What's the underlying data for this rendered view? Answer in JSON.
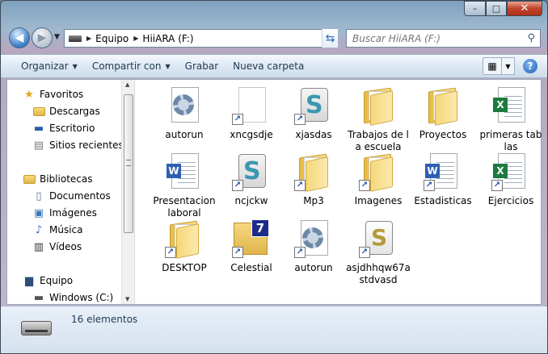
{
  "window": {
    "minimize": "–",
    "maximize": "□",
    "close": "✕"
  },
  "nav": {
    "breadcrumb": [
      "Equipo",
      "HiiARA (F:)"
    ],
    "search_placeholder": "Buscar HiiARA (F:)"
  },
  "toolbar": {
    "organize": "Organizar",
    "share": "Compartir con",
    "burn": "Grabar",
    "new_folder": "Nueva carpeta"
  },
  "sidebar": {
    "favorites": "Favoritos",
    "fav_items": [
      "Descargas",
      "Escritorio",
      "Sitios recientes"
    ],
    "libraries": "Bibliotecas",
    "lib_items": [
      "Documentos",
      "Imágenes",
      "Música",
      "Vídeos"
    ],
    "computer": "Equipo",
    "comp_items": [
      "Windows (C:)"
    ]
  },
  "files": [
    {
      "name": "autorun",
      "type": "gear",
      "shortcut": false
    },
    {
      "name": "xncgsdje",
      "type": "blank",
      "shortcut": true
    },
    {
      "name": "xjasdas",
      "type": "script",
      "shortcut": true
    },
    {
      "name": "Trabajos de la escuela",
      "type": "folder",
      "shortcut": false
    },
    {
      "name": "Proyectos",
      "type": "folder",
      "shortcut": false
    },
    {
      "name": "primeras tablas",
      "type": "excel",
      "shortcut": false
    },
    {
      "name": "Presentacion laboral",
      "type": "word",
      "shortcut": false
    },
    {
      "name": "ncjckw",
      "type": "script",
      "shortcut": true
    },
    {
      "name": "Mp3",
      "type": "folder",
      "shortcut": true
    },
    {
      "name": "Imagenes",
      "type": "folder",
      "shortcut": true
    },
    {
      "name": "Estadisticas",
      "type": "word",
      "shortcut": true
    },
    {
      "name": "Ejercicios",
      "type": "excel",
      "shortcut": true
    },
    {
      "name": "DESKTOP",
      "type": "folder",
      "shortcut": true
    },
    {
      "name": "Celestial",
      "type": "celestial",
      "shortcut": true
    },
    {
      "name": "autorun",
      "type": "gear",
      "shortcut": true
    },
    {
      "name": "asjdhhqw67astdvasd",
      "type": "batch",
      "shortcut": true
    }
  ],
  "status": {
    "count": "16 elementos"
  }
}
